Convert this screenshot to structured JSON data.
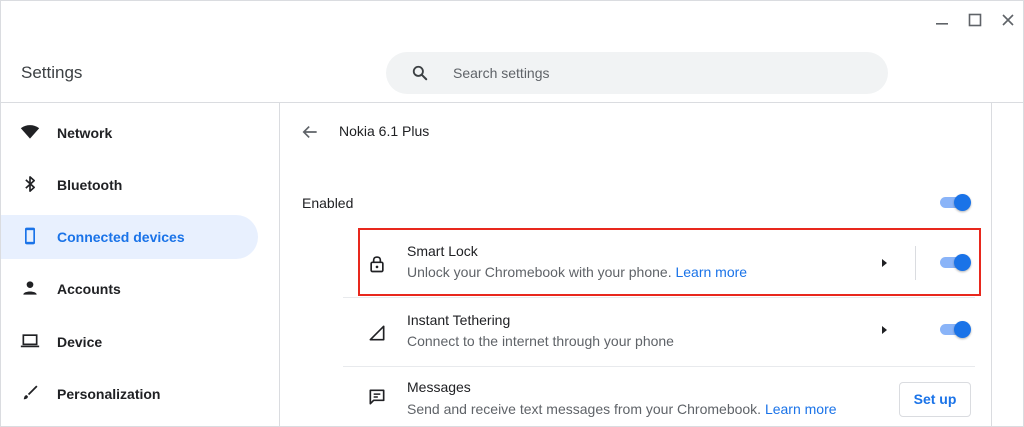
{
  "window": {
    "controls": {
      "minimize": "minimize-icon",
      "maximize": "maximize-icon",
      "close": "close-icon"
    }
  },
  "header": {
    "title": "Settings",
    "search": {
      "placeholder": "Search settings",
      "icon": "search-icon"
    }
  },
  "sidebar": {
    "items": [
      {
        "label": "Network",
        "icon": "wifi-icon",
        "active": false
      },
      {
        "label": "Bluetooth",
        "icon": "bluetooth-icon",
        "active": false
      },
      {
        "label": "Connected devices",
        "icon": "phone-icon",
        "active": true
      },
      {
        "label": "Accounts",
        "icon": "person-icon",
        "active": false
      },
      {
        "label": "Device",
        "icon": "laptop-icon",
        "active": false
      },
      {
        "label": "Personalization",
        "icon": "brush-icon",
        "active": false
      }
    ]
  },
  "main": {
    "page_title": "Nokia 6.1 Plus",
    "enabled": {
      "label": "Enabled",
      "on": true
    },
    "features": [
      {
        "title": "Smart Lock",
        "desc": "Unlock your Chromebook with your phone.",
        "link": "Learn more",
        "icon": "lock-icon",
        "toggle_on": true,
        "highlighted": true
      },
      {
        "title": "Instant Tethering",
        "desc": "Connect to the internet through your phone",
        "link": "",
        "icon": "signal-icon",
        "toggle_on": true,
        "highlighted": false
      },
      {
        "title": "Messages",
        "desc": "Send and receive text messages from your Chromebook.",
        "link": "Learn more",
        "icon": "message-icon",
        "action_label": "Set up",
        "highlighted": false
      }
    ]
  },
  "colors": {
    "accent": "#1a73e8",
    "active_bg": "#e8f0fe",
    "highlight_border": "#e8281d"
  }
}
